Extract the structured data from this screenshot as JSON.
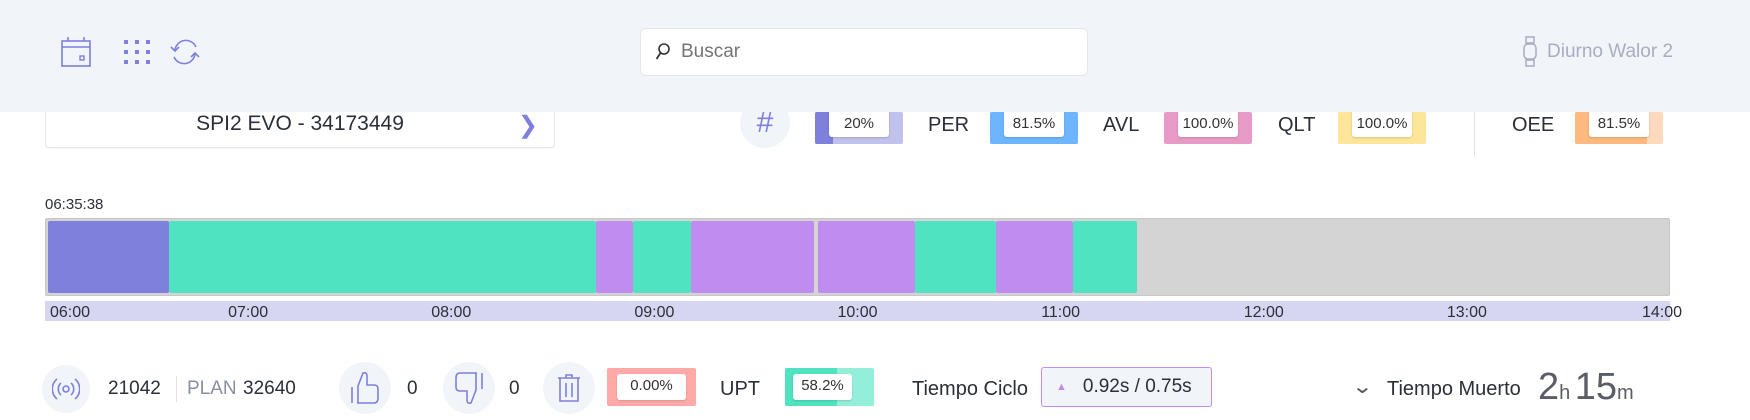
{
  "header": {
    "search_placeholder": "Buscar",
    "user": "Diurno Walor 2"
  },
  "machine": {
    "name": "SPI2 EVO - 34173449"
  },
  "kpis": {
    "first": {
      "value": "20%",
      "fill": 0.2,
      "color_dark": "#7e80dc",
      "color_light": "#c0c1ec"
    },
    "per": {
      "label": "PER",
      "value": "81.5%",
      "color": "#6db5ff"
    },
    "avl": {
      "label": "AVL",
      "value": "100.0%",
      "color": "#e89bc6"
    },
    "qlt": {
      "label": "QLT",
      "value": "100.0%",
      "color": "#fde59a"
    },
    "oee": {
      "label": "OEE",
      "value": "81.5%",
      "fill": 0.815,
      "color_dark": "#fdb97e",
      "color_light": "#fdd9bd"
    }
  },
  "timeline": {
    "start_timestamp": "06:35:38",
    "axis_start_min": 0,
    "axis_end_min": 480,
    "ticks": [
      "06:00",
      "07:00",
      "08:00",
      "09:00",
      "10:00",
      "11:00",
      "12:00",
      "13:00",
      "14:00"
    ],
    "segments": [
      {
        "start": 0,
        "end": 36,
        "color": "#7e80dc"
      },
      {
        "start": 36,
        "end": 162.5,
        "color": "#4fe3c2"
      },
      {
        "start": 162.5,
        "end": 173.4,
        "color": "#c18cf0"
      },
      {
        "start": 173.4,
        "end": 190.5,
        "color": "#4fe3c2"
      },
      {
        "start": 190.5,
        "end": 227,
        "color": "#c18cf0"
      },
      {
        "start": 228.4,
        "end": 257,
        "color": "#c18cf0"
      },
      {
        "start": 257,
        "end": 281,
        "color": "#4fe3c2"
      },
      {
        "start": 281,
        "end": 304,
        "color": "#c18cf0"
      },
      {
        "start": 304,
        "end": 323,
        "color": "#4fe3c2"
      }
    ]
  },
  "stats": {
    "count": "21042",
    "plan_label": "PLAN",
    "plan": "32640",
    "good": "0",
    "bad": "0",
    "scrap": {
      "value": "0.00%",
      "color": "#ffaaa8"
    },
    "upt": {
      "label": "UPT",
      "value": "58.2%",
      "fill": 0.582,
      "color_dark": "#4fe3c2",
      "color_light": "#94efd9"
    },
    "cycle": {
      "label": "Tiempo Ciclo",
      "value": "0.92s / 0.75s"
    },
    "dead": {
      "label": "Tiempo Muerto",
      "hours": "2",
      "h_unit": "h",
      "minutes": "15",
      "m_unit": "m"
    }
  }
}
